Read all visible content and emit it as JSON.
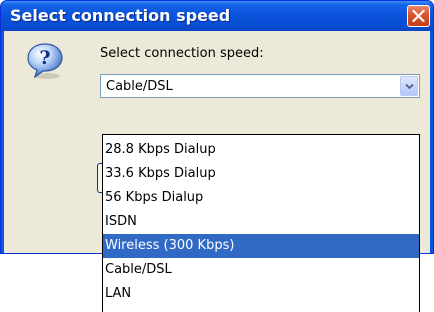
{
  "window": {
    "title": "Select connection speed",
    "close_icon": "close-icon"
  },
  "dialog": {
    "icon": "question-icon",
    "prompt": "Select connection speed:",
    "combo": {
      "selected_value": "Cable/DSL",
      "arrow_icon": "chevron-down-icon"
    },
    "options": [
      "28.8 Kbps Dialup",
      "33.6 Kbps Dialup",
      "56 Kbps Dialup",
      "ISDN",
      "Wireless (300 Kbps)",
      "Cable/DSL",
      "LAN"
    ],
    "highlighted_option": "Wireless (300 Kbps)"
  },
  "colors": {
    "titlebar": "#0a55e0",
    "client": "#ece9d8",
    "selection": "#316ac5",
    "close": "#d9532a"
  }
}
